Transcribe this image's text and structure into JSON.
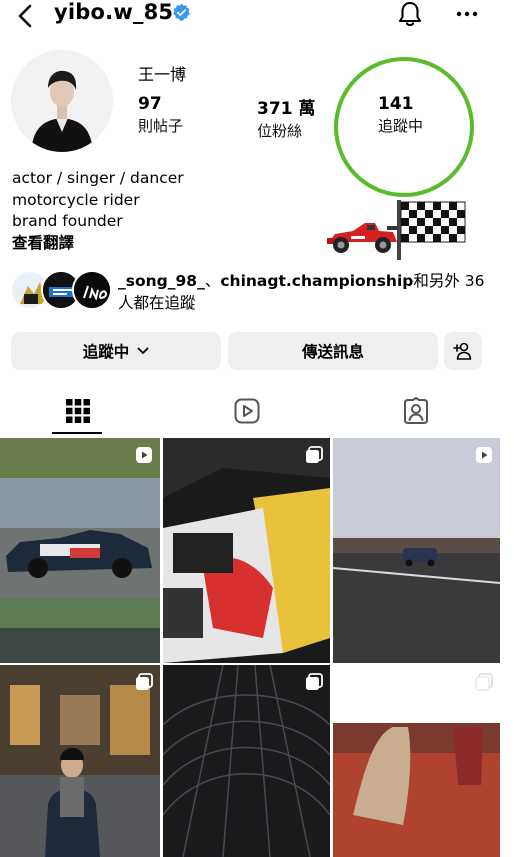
{
  "header": {
    "username": "yibo.w_85",
    "verified_icon": "verified-badge-icon",
    "back_icon": "back-chevron-icon",
    "bell_icon": "bell-icon",
    "more_icon": "more-dots-icon"
  },
  "profile": {
    "display_name": "王一博",
    "stats": [
      {
        "count": "97",
        "label": "則帖子"
      },
      {
        "count": "371 萬",
        "label": "位粉絲"
      },
      {
        "count": "141",
        "label": "追蹤中"
      }
    ],
    "annotation_circle_color": "#5abb2b",
    "bio_lines": [
      "actor / singer / dancer",
      "motorcycle rider",
      "brand founder"
    ],
    "translate_label": "查看翻譯",
    "bio_emoji": [
      "🏎️",
      "🏁"
    ]
  },
  "mutual": {
    "name_1": "_song_98_",
    "separator": "、",
    "name_2": "chinagt.championship",
    "suffix": "和另外 36 人都在追蹤"
  },
  "actions": {
    "following_label": "追蹤中",
    "message_label": "傳送訊息",
    "add_user_icon": "add-user-icon"
  },
  "tabs": [
    "grid-icon",
    "reels-icon",
    "tagged-icon"
  ],
  "colors": {
    "verified": "#3897f0",
    "button_bg": "#efeff1"
  },
  "posts": [
    {
      "type": "reel",
      "icon": "reel-badge-icon"
    },
    {
      "type": "carousel",
      "icon": "carousel-badge-icon"
    },
    {
      "type": "reel",
      "icon": "reel-badge-icon"
    },
    {
      "type": "carousel",
      "icon": "carousel-badge-icon"
    },
    {
      "type": "carousel",
      "icon": "carousel-badge-icon"
    },
    {
      "type": "carousel",
      "icon": "carousel-badge-icon"
    }
  ]
}
